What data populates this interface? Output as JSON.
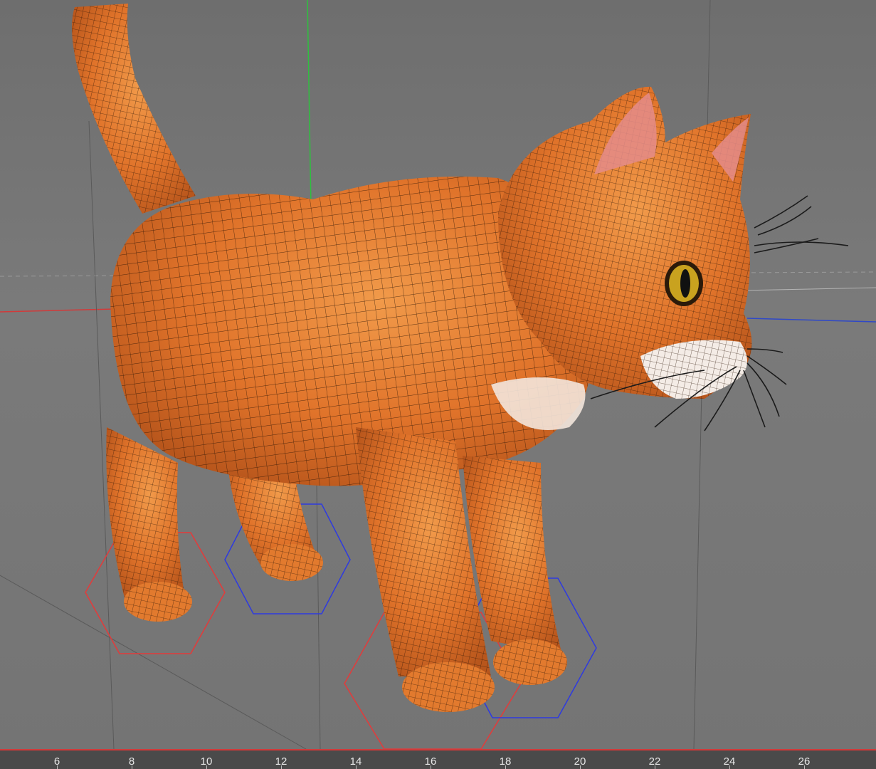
{
  "viewport": {
    "object": "cat-mesh",
    "background": "#767676",
    "mesh_color": "#e4782a",
    "axis_colors": {
      "x": "#d23a3a",
      "y": "#2fbf3f",
      "z": "#2f48c8"
    }
  },
  "timeline": {
    "ticks": [
      "6",
      "8",
      "10",
      "12",
      "14",
      "16",
      "18",
      "20",
      "22",
      "24",
      "26"
    ]
  }
}
